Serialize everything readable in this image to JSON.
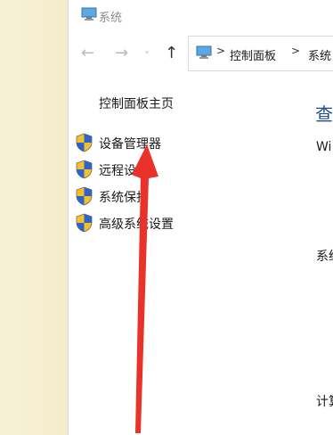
{
  "window": {
    "title": "系统"
  },
  "navbar": {
    "back_glyph": "←",
    "forward_glyph": "→",
    "dropdown_glyph": "˅",
    "up_glyph": "↑"
  },
  "address": {
    "separator": ">",
    "crumbs": [
      "控制面板",
      "系统"
    ]
  },
  "sidebar": {
    "home_link": "控制面板主页",
    "items": [
      {
        "label": "设备管理器"
      },
      {
        "label": "远程设置"
      },
      {
        "label": "系统保护"
      },
      {
        "label": "高级系统设置"
      }
    ]
  },
  "main": {
    "heading": "查",
    "line1": "Wi",
    "line2": "系统",
    "line3": "计算"
  },
  "colors": {
    "arrow": "#e8322a",
    "shield_blue": "#2f63c8",
    "shield_yellow": "#f2c02a",
    "heading": "#1e4e8c"
  }
}
